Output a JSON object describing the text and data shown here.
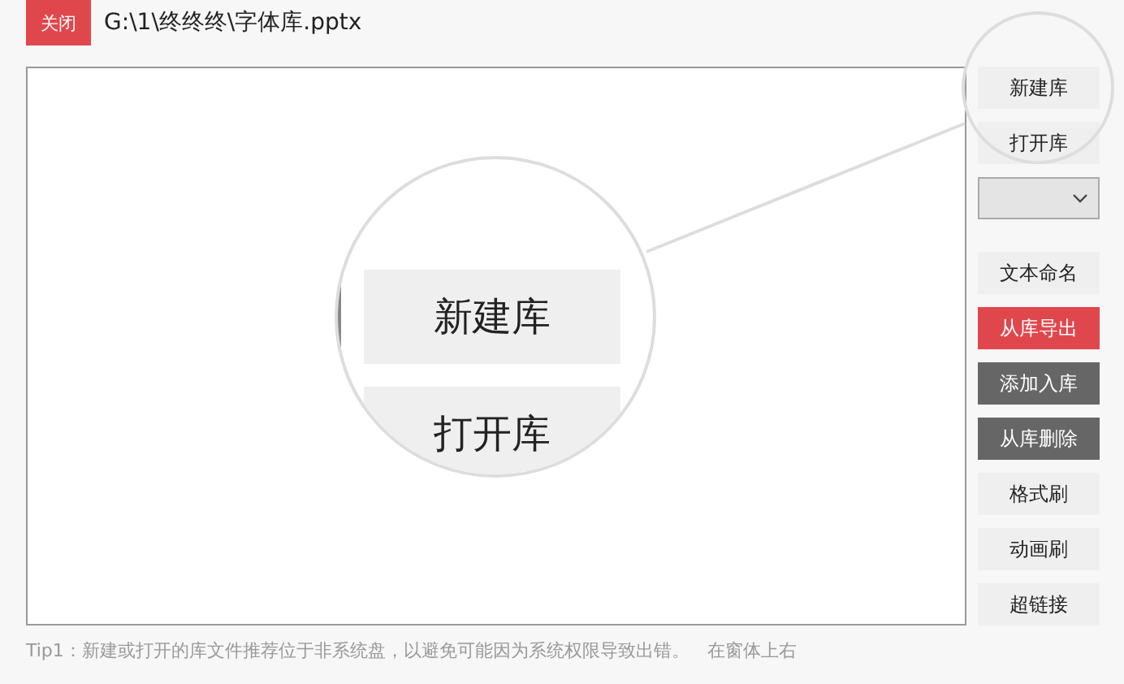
{
  "top_bar": {
    "close_button": "关闭",
    "file_path": "G:\\1\\终终终\\字体库.pptx"
  },
  "side_buttons": [
    {
      "label": "新建库",
      "kind": "plain"
    },
    {
      "label": "打开库",
      "kind": "plain"
    },
    {
      "kind": "dropdown"
    },
    {
      "label": "文本命名",
      "kind": "plain"
    },
    {
      "label": "从库导出",
      "kind": "accent"
    },
    {
      "label": "添加入库",
      "kind": "dark"
    },
    {
      "label": "从库删除",
      "kind": "dark"
    },
    {
      "label": "格式刷",
      "kind": "plain"
    },
    {
      "label": "动画刷",
      "kind": "plain"
    },
    {
      "label": "超链接",
      "kind": "plain"
    }
  ],
  "magnifier": {
    "labels": [
      "新建库",
      "打开库"
    ]
  },
  "tip": "Tip1：新建或打开的库文件推荐位于非系统盘，以避免可能因为系统权限导致出错。　在窗体上右"
}
